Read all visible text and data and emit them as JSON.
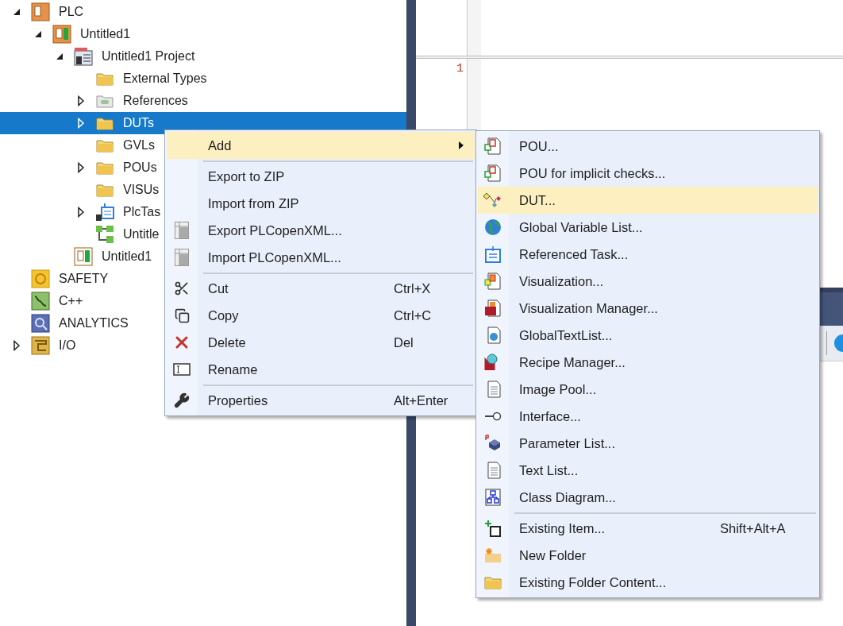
{
  "tree": [
    {
      "label": "PLC",
      "kind": "plc",
      "expanded": true,
      "selected": false,
      "children": [
        {
          "label": "Untitled1",
          "kind": "plc-instance",
          "expanded": true,
          "selected": false,
          "children": [
            {
              "label": "Untitled1 Project",
              "kind": "project",
              "expanded": true,
              "selected": false,
              "children": [
                {
                  "label": "External Types",
                  "kind": "folder",
                  "selected": false
                },
                {
                  "label": "References",
                  "kind": "references",
                  "expanded": false,
                  "selected": false
                },
                {
                  "label": "DUTs",
                  "kind": "folder",
                  "expanded": false,
                  "selected": true
                },
                {
                  "label": "GVLs",
                  "kind": "folder",
                  "selected": false
                },
                {
                  "label": "POUs",
                  "kind": "folder",
                  "expanded": false,
                  "selected": false
                },
                {
                  "label": "VISUs",
                  "kind": "folder",
                  "selected": false
                },
                {
                  "label": "PlcTas",
                  "kind": "task",
                  "expanded": false,
                  "selected": false
                },
                {
                  "label": "Untitle",
                  "kind": "instance",
                  "selected": false
                }
              ]
            },
            {
              "label": "Untitled1",
              "kind": "plc-small",
              "selected": false
            }
          ]
        }
      ]
    },
    {
      "label": "SAFETY",
      "kind": "safety",
      "selected": false
    },
    {
      "label": "C++",
      "kind": "cpp",
      "selected": false
    },
    {
      "label": "ANALYTICS",
      "kind": "analytics",
      "selected": false
    },
    {
      "label": "I/O",
      "kind": "io",
      "expanded": false,
      "selected": false
    }
  ],
  "editor": {
    "line_numbers": [
      "1"
    ]
  },
  "context_menu": {
    "items": [
      {
        "kind": "item",
        "label": "Add",
        "submenu": true,
        "selected": true
      },
      {
        "kind": "separator"
      },
      {
        "kind": "item",
        "label": "Export to ZIP",
        "selected": false
      },
      {
        "kind": "item",
        "label": "Import from ZIP",
        "selected": false
      },
      {
        "kind": "item",
        "label": "Export PLCopenXML...",
        "selected": false
      },
      {
        "kind": "item",
        "label": "Import PLCopenXML...",
        "selected": false
      },
      {
        "kind": "separator"
      },
      {
        "kind": "item",
        "label": "Cut",
        "shortcut": "Ctrl+X",
        "selected": false
      },
      {
        "kind": "item",
        "label": "Copy",
        "shortcut": "Ctrl+C",
        "selected": false
      },
      {
        "kind": "item",
        "label": "Delete",
        "shortcut": "Del",
        "selected": false
      },
      {
        "kind": "item",
        "label": "Rename",
        "selected": false
      },
      {
        "kind": "separator"
      },
      {
        "kind": "item",
        "label": "Properties",
        "shortcut": "Alt+Enter",
        "selected": false
      }
    ]
  },
  "add_submenu": {
    "items": [
      {
        "kind": "item",
        "label": "POU...",
        "selected": false
      },
      {
        "kind": "item",
        "label": "POU for implicit checks...",
        "selected": false
      },
      {
        "kind": "item",
        "label": "DUT...",
        "selected": true
      },
      {
        "kind": "item",
        "label": "Global Variable List...",
        "selected": false
      },
      {
        "kind": "item",
        "label": "Referenced Task...",
        "selected": false
      },
      {
        "kind": "item",
        "label": "Visualization...",
        "selected": false
      },
      {
        "kind": "item",
        "label": "Visualization Manager...",
        "selected": false
      },
      {
        "kind": "item",
        "label": "GlobalTextList...",
        "selected": false
      },
      {
        "kind": "item",
        "label": "Recipe Manager...",
        "selected": false
      },
      {
        "kind": "item",
        "label": "Image Pool...",
        "selected": false
      },
      {
        "kind": "item",
        "label": "Interface...",
        "selected": false
      },
      {
        "kind": "item",
        "label": "Parameter List...",
        "selected": false
      },
      {
        "kind": "item",
        "label": "Text List...",
        "selected": false
      },
      {
        "kind": "item",
        "label": "Class Diagram...",
        "selected": false
      },
      {
        "kind": "separator"
      },
      {
        "kind": "item",
        "label": "Existing Item...",
        "shortcut": "Shift+Alt+A",
        "selected": false
      },
      {
        "kind": "item",
        "label": "New Folder",
        "selected": false
      },
      {
        "kind": "item",
        "label": "Existing Folder Content...",
        "selected": false
      }
    ]
  }
}
